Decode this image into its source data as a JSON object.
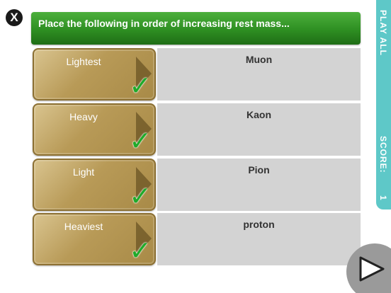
{
  "header": {
    "close_label": "X",
    "title": "Place the following in order of increasing rest mass..."
  },
  "side_tab": {
    "play_all": "PLAY ALL",
    "score_label": "SCORE:",
    "score_value": "1"
  },
  "rows": [
    {
      "label": "Lightest",
      "answer": "Muon",
      "correct": true
    },
    {
      "label": "Heavy",
      "answer": "Kaon",
      "correct": true
    },
    {
      "label": "Light",
      "answer": "Pion",
      "correct": true
    },
    {
      "label": "Heaviest",
      "answer": "proton",
      "correct": true
    }
  ],
  "icons": {
    "close": "close-icon",
    "check": "checkmark-icon",
    "arrow": "arrow-right-icon",
    "next": "play-next-icon"
  },
  "colors": {
    "header_green": "#2e8f22",
    "tile_gold": "#b89a57",
    "check_green": "#1faa2a",
    "side_teal": "#5ec8c8",
    "answer_gray": "#d3d3d3"
  }
}
